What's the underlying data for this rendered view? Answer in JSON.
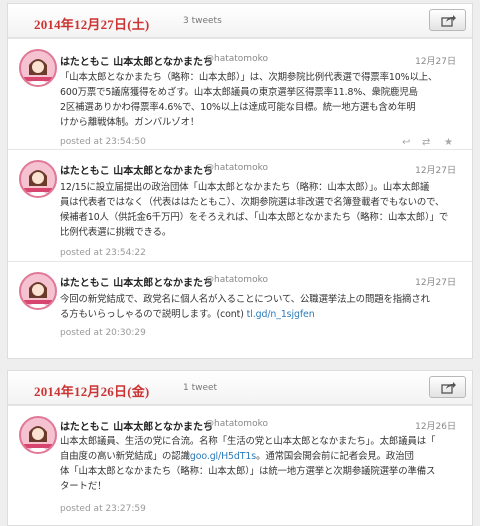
{
  "days": [
    {
      "date": "2014年12月27日(土)",
      "count": "3 tweets",
      "tweets": [
        {
          "name": "はたともこ 山本太郎となかまたち",
          "handle": "@hatatomoko",
          "date": "12月27日",
          "lines": [
            "「山本太郎となかまたち（略称：山本太郎）」は、次期参院比例代表選で得票率10%以上、",
            "600万票で5議席獲得をめざす。山本太郎議員の東京選挙区得票率11.8%、衆院鹿児島",
            "2区補選ありかわ得票率4.6%で、10%以上は達成可能な目標。統一地方選も含め年明",
            "けから離戦体制。ガンバルゾオ！"
          ],
          "posted": "posted at 23:54:50"
        },
        {
          "name": "はたともこ 山本太郎となかまたち",
          "handle": "@hatatomoko",
          "date": "12月27日",
          "lines": [
            "12/15に設立届提出の政治団体「山本太郎となかまたち（略称：山本太郎）」。山本太郎議",
            "員は代表者ではなく（代表ははたともこ）、次期参院選は非改選で名簿登載者でもないので、",
            "候補者10人（供託金6千万円）をそろえれば、「山本太郎となかまたち（略称：山本太郎）」で",
            "比例代表選に挑戦できる。"
          ],
          "posted": "posted at 23:54:22"
        },
        {
          "name": "はたともこ 山本太郎となかまたち",
          "handle": "@hatatomoko",
          "date": "12月27日",
          "lines": [
            "今回の新党結成で、政党名に個人名が入ることについて、公職選挙法上の問題を指摘され",
            "る方もいらっしゃるので説明します。(cont)"
          ],
          "link": "tl.gd/n_1sjgfen",
          "posted": "posted at 20:30:29"
        }
      ]
    },
    {
      "date": "2014年12月26日(金)",
      "count": "1 tweet",
      "tweets": [
        {
          "name": "はたともこ 山本太郎となかまたち",
          "handle": "@hatatomoko",
          "date": "12月26日",
          "line1": "山本太郎議員、生活の党に合流。名称「生活の党と山本太郎となかまたち」。太郎議員は「",
          "line2_a": "自由度の高い新党結成」の認識",
          "line2_link": "goo.gl/H5dT1s",
          "line2_b": "。通常国会開会前に記者会見。政治団",
          "line3": "体「山本太郎となかまたち（略称：山本太郎）」は統一地方選挙と次期参議院選挙の準備ス",
          "line4": "タートだ！",
          "posted": "posted at 23:27:59"
        }
      ]
    }
  ],
  "icons": {
    "share": "share-icon",
    "reply": "reply-icon",
    "retweet": "retweet-icon",
    "favorite": "star-icon",
    "avatar": "avatar"
  },
  "colors": {
    "date": "#cc3333",
    "link": "#2b7bb9",
    "background": "#eeeeee"
  }
}
